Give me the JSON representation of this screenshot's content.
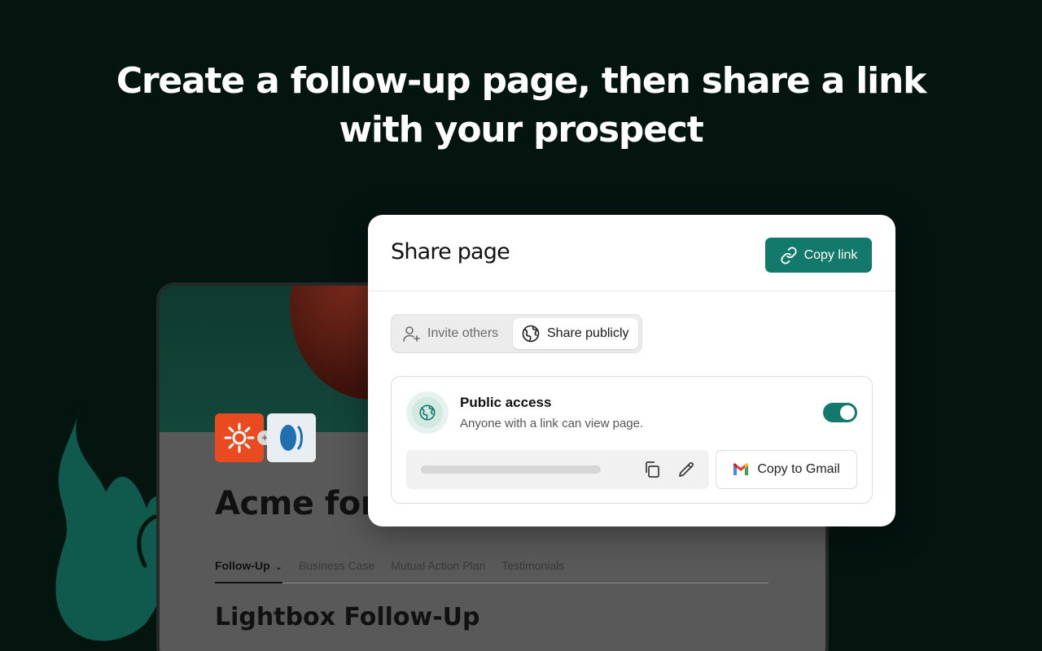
{
  "headline": {
    "line1": "Create a follow-up page, then share a link",
    "line2": "with your prospect"
  },
  "background_page": {
    "title": "Acme for",
    "tabs": [
      {
        "label": "Follow-Up",
        "active": true
      },
      {
        "label": "Business Case",
        "active": false
      },
      {
        "label": "Mutual Action Plan",
        "active": false
      },
      {
        "label": "Testimonials",
        "active": false
      }
    ],
    "section_heading": "Lightbox Follow-Up",
    "logo_separator": "+"
  },
  "share_modal": {
    "title": "Share page",
    "copy_link_label": "Copy link",
    "tabs": {
      "invite": "Invite others",
      "public": "Share publicly"
    },
    "active_tab": "public",
    "public_access": {
      "title": "Public access",
      "description": "Anyone with a link can view page.",
      "enabled": true
    },
    "copy_to_gmail_label": "Copy to Gmail"
  },
  "colors": {
    "background": "#04140f",
    "accent": "#137a6b",
    "flame": "#0f5a4c"
  },
  "icons": {
    "copy_link": "link-icon",
    "invite": "user-plus-icon",
    "public": "globe-icon",
    "copy": "copy-icon",
    "edit": "pencil-icon",
    "gmail": "gmail-icon"
  }
}
